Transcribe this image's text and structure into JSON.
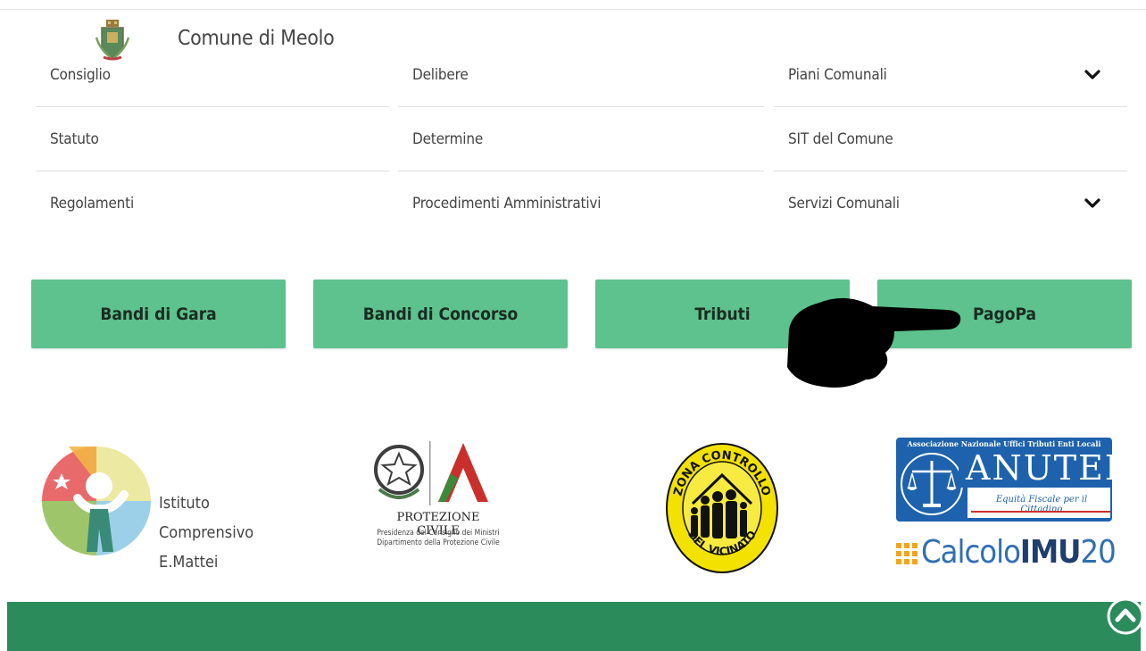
{
  "header": {
    "title": "Comune di Meolo",
    "logo_icon": "municipal-coat-of-arms-icon"
  },
  "menu": {
    "col1": [
      {
        "label": "Consiglio"
      },
      {
        "label": "Statuto"
      },
      {
        "label": "Regolamenti"
      }
    ],
    "col2": [
      {
        "label": "Delibere"
      },
      {
        "label": "Determine"
      },
      {
        "label": "Procedimenti Amministrativi"
      }
    ],
    "col3": [
      {
        "label": "Piani Comunali",
        "dropdown": true
      },
      {
        "label": "SIT del Comune",
        "dropdown": false
      },
      {
        "label": "Servizi Comunali",
        "dropdown": true
      }
    ]
  },
  "buttons": [
    {
      "label": "Bandi di Gara"
    },
    {
      "label": "Bandi di Concorso"
    },
    {
      "label": "Tributi"
    },
    {
      "label": "PagoPa"
    }
  ],
  "partners": {
    "istituto": {
      "line1": "Istituto",
      "line2": "Comprensivo",
      "line3": "E.Mattei"
    },
    "protezione": {
      "title": "PROTEZIONE CIVILE",
      "sub1": "Presidenza del Consiglio dei Ministri",
      "sub2": "Dipartimento della Protezione Civile"
    },
    "zona": {
      "top": "ZONA CONTROLLO",
      "bottom": "DEL VICINATO"
    },
    "anutel": {
      "top": "Associazione Nazionale Uffici Tributi Enti Locali",
      "name": "ANUTEL",
      "tagline": "Equità Fiscale per il Cittadino"
    },
    "calcolo": {
      "part1": "Calcolo",
      "part2": "IMU",
      "part3": "20"
    }
  },
  "colors": {
    "button": "#5dc28d",
    "footer": "#2b8b5b",
    "anutel_blue": "#1e62ad"
  },
  "overlay": {
    "icon": "pointing-hand-icon"
  },
  "scroll_top": {
    "icon": "chevron-up-circle-icon"
  }
}
